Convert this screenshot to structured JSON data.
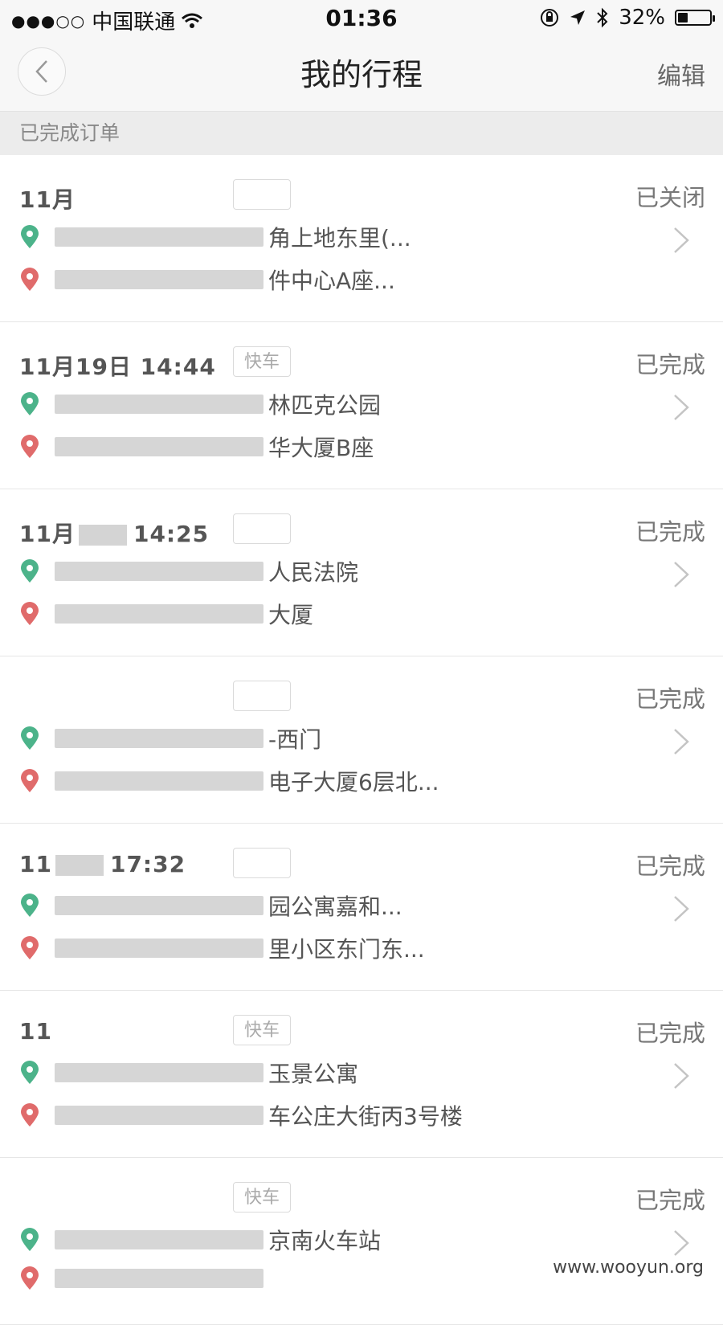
{
  "status_bar": {
    "carrier": "中国联通",
    "time": "01:36",
    "battery_text": "32%",
    "battery_level": 0.32
  },
  "nav": {
    "title": "我的行程",
    "edit": "编辑"
  },
  "section": {
    "title": "已完成订单"
  },
  "trips": [
    {
      "date": "11月",
      "tag": "",
      "status": "已关闭",
      "start": "角上地东里(...",
      "end": "件中心A座..."
    },
    {
      "date": "11月19日 14:44",
      "tag": "快车",
      "status": "已完成",
      "start": "林匹克公园",
      "end": "华大厦B座"
    },
    {
      "date": "11月",
      "time": "14:25",
      "tag": "",
      "status": "已完成",
      "start": "人民法院",
      "end": "大厦"
    },
    {
      "date": "",
      "tag": "",
      "status": "已完成",
      "start": "-西门",
      "end": "电子大厦6层北..."
    },
    {
      "date": "11",
      "time": "17:32",
      "tag": "",
      "status": "已完成",
      "start": "园公寓嘉和...",
      "end": "里小区东门东..."
    },
    {
      "date": "11",
      "tag": "快车",
      "status": "已完成",
      "start": "玉景公寓",
      "end": "车公庄大街丙3号楼"
    },
    {
      "date": "",
      "tag": "快车",
      "status": "已完成",
      "start": "京南火车站",
      "end": ""
    }
  ],
  "watermark": "www.wooyun.org",
  "colors": {
    "start_pin": "#4cb38a",
    "end_pin": "#e06b6b",
    "nav_bg": "#f7f7f7"
  }
}
